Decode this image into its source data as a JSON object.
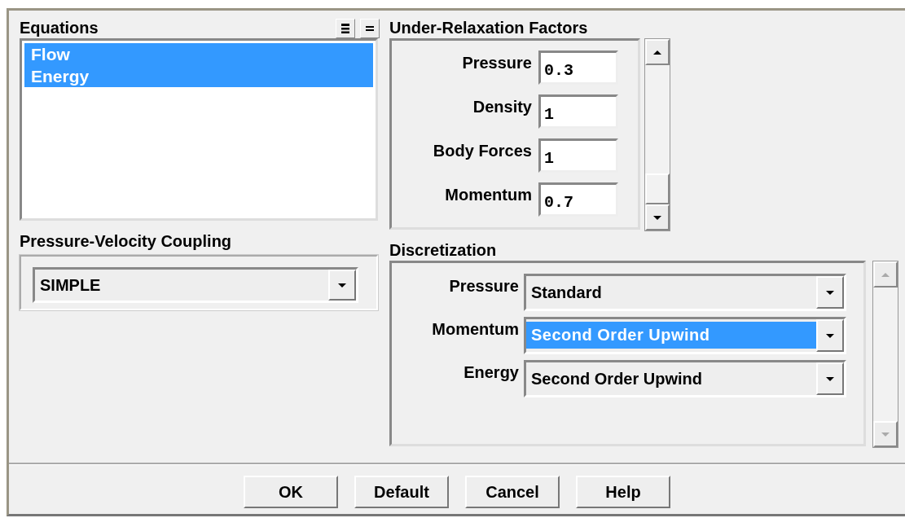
{
  "equations": {
    "title": "Equations",
    "items": [
      {
        "label": "Flow",
        "selected": true
      },
      {
        "label": "Energy",
        "selected": true
      }
    ]
  },
  "pressure_velocity_coupling": {
    "title": "Pressure-Velocity Coupling",
    "value": "SIMPLE"
  },
  "under_relaxation_factors": {
    "title": "Under-Relaxation Factors",
    "fields": [
      {
        "label": "Pressure",
        "value": "0.3"
      },
      {
        "label": "Density",
        "value": "1"
      },
      {
        "label": "Body Forces",
        "value": "1"
      },
      {
        "label": "Momentum",
        "value": "0.7"
      }
    ]
  },
  "discretization": {
    "title": "Discretization",
    "rows": [
      {
        "label": "Pressure",
        "value": "Standard",
        "selected": false
      },
      {
        "label": "Momentum",
        "value": "Second Order Upwind",
        "selected": true
      },
      {
        "label": "Energy",
        "value": "Second Order Upwind",
        "selected": false
      }
    ]
  },
  "buttons": [
    "OK",
    "Default",
    "Cancel",
    "Help"
  ]
}
